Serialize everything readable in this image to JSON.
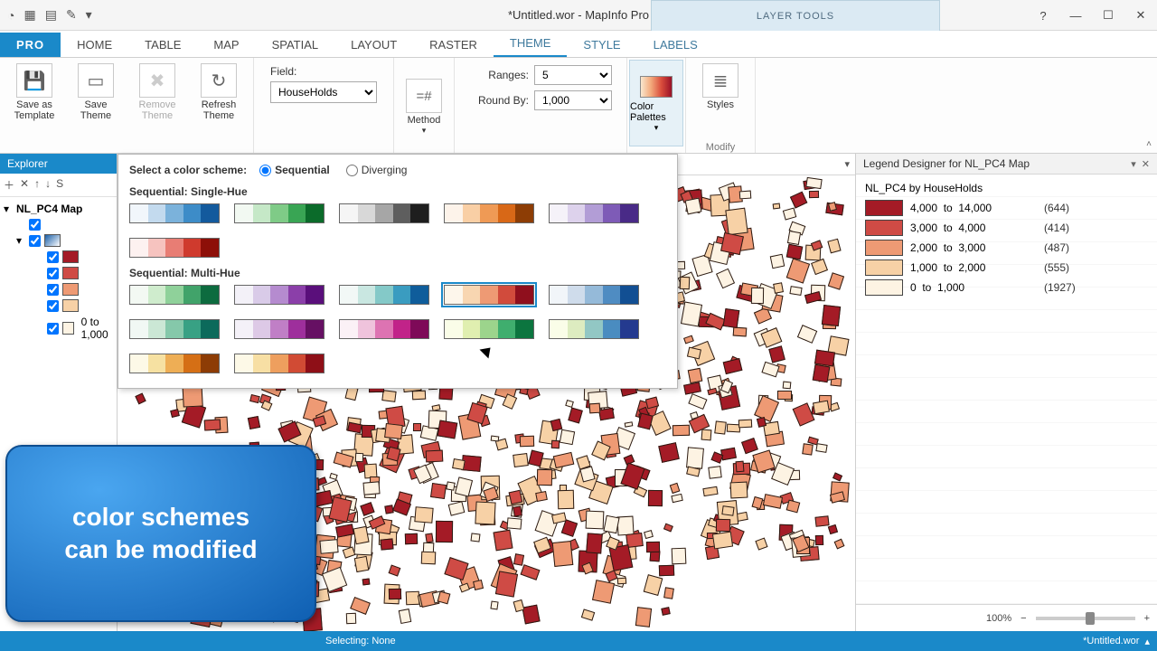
{
  "title": "*Untitled.wor - MapInfo Pro",
  "context_tab": "LAYER TOOLS",
  "tabs": {
    "pro": "PRO",
    "home": "HOME",
    "table": "TABLE",
    "map": "MAP",
    "spatial": "SPATIAL",
    "layout": "LAYOUT",
    "raster": "RASTER",
    "theme": "THEME",
    "style": "STYLE",
    "labels": "LABELS"
  },
  "ribbon": {
    "save_template": "Save as Template",
    "save_theme": "Save Theme",
    "remove_theme": "Remove Theme",
    "refresh_theme": "Refresh Theme",
    "field_label": "Field:",
    "field_value": "HouseHolds",
    "method_label": "Method",
    "ranges_label": "Ranges:",
    "ranges_value": "5",
    "roundby_label": "Round By:",
    "roundby_value": "1,000",
    "color_palettes": "Color Palettes",
    "styles": "Styles",
    "modify_group": "Modify"
  },
  "popup": {
    "prompt": "Select a color scheme:",
    "opt_sequential": "Sequential",
    "opt_diverging": "Diverging",
    "section_single": "Sequential: Single-Hue",
    "section_multi": "Sequential: Multi-Hue",
    "single_schemes": [
      [
        "#f1f6fb",
        "#c3daee",
        "#7bb2db",
        "#3d8cc8",
        "#135a9d"
      ],
      [
        "#f2f9f2",
        "#c5e8c7",
        "#7fcb87",
        "#39a554",
        "#0b6b2a"
      ],
      [
        "#f5f5f5",
        "#d8d8d8",
        "#a6a6a6",
        "#5e5e5e",
        "#1e1e1e"
      ],
      [
        "#fdf3ea",
        "#f9cfa5",
        "#ef9a55",
        "#d86817",
        "#8d3d05"
      ],
      [
        "#f5f2f9",
        "#ddd2ec",
        "#b29dd6",
        "#7e5bb7",
        "#492a87"
      ],
      [
        "#fdf1f0",
        "#f6c3bf",
        "#e87d74",
        "#cf3a2d",
        "#8d0f08"
      ]
    ],
    "multi_schemes": [
      [
        "#f3f9f3",
        "#cfeccd",
        "#8fd19a",
        "#41a36a",
        "#0d6b3f"
      ],
      [
        "#f3f1f8",
        "#d9cbe8",
        "#b58bcf",
        "#8b3fa9",
        "#5a0f7b"
      ],
      [
        "#f2f8f6",
        "#c9e7e1",
        "#84c9c8",
        "#3a9cc0",
        "#0f5d9b"
      ],
      [
        "#fdf6eb",
        "#f8d6b1",
        "#ee9a74",
        "#d14b3c",
        "#8f0f1d"
      ],
      [
        "#f1f5f9",
        "#cfdceb",
        "#95bad9",
        "#4f8cc2",
        "#124f93"
      ],
      [
        "#f1f8f4",
        "#cbe7d5",
        "#85c8aa",
        "#38a184",
        "#0c6a5b"
      ],
      [
        "#f4f1f8",
        "#ddc9e6",
        "#c07fc6",
        "#9e2f9c",
        "#661063"
      ],
      [
        "#fbf1f6",
        "#efc3dc",
        "#dd73b2",
        "#c12389",
        "#7e0a58"
      ],
      [
        "#fafde8",
        "#e0efb0",
        "#9cd48c",
        "#3fae6e",
        "#0c753f"
      ],
      [
        "#fafde8",
        "#ddecc0",
        "#92c7c4",
        "#4a8cc0",
        "#243a8f"
      ],
      [
        "#fdf9e7",
        "#f6e1a2",
        "#eeae55",
        "#d56f15",
        "#8d3c05"
      ],
      [
        "#fdf9e7",
        "#f7dfa4",
        "#ee9f5e",
        "#d14b34",
        "#8e0f17"
      ]
    ],
    "selected_multi_index": 3
  },
  "explorer": {
    "title": "Explorer",
    "map_name": "NL_PC4 Map",
    "last_range": "0 to 1,000"
  },
  "legend": {
    "title": "Legend Designer for NL_PC4 Map",
    "subtitle": "NL_PC4 by HouseHolds",
    "rows": [
      {
        "color": "#a41b26",
        "from": "4,000",
        "to": "14,000",
        "count": "(644)"
      },
      {
        "color": "#cf4b45",
        "from": "3,000",
        "to": "4,000",
        "count": "(414)"
      },
      {
        "color": "#ee9a74",
        "from": "2,000",
        "to": "3,000",
        "count": "(487)"
      },
      {
        "color": "#f7d1a6",
        "from": "1,000",
        "to": "2,000",
        "count": "(555)"
      },
      {
        "color": "#fdf3e3",
        "from": "0",
        "to": "1,000",
        "count": "(1927)"
      }
    ],
    "zoom": "100%"
  },
  "status": {
    "selecting": "Selecting: None",
    "doc": "*Untitled.wor"
  },
  "callout": {
    "line1": "color schemes",
    "line2": "can be modified"
  }
}
